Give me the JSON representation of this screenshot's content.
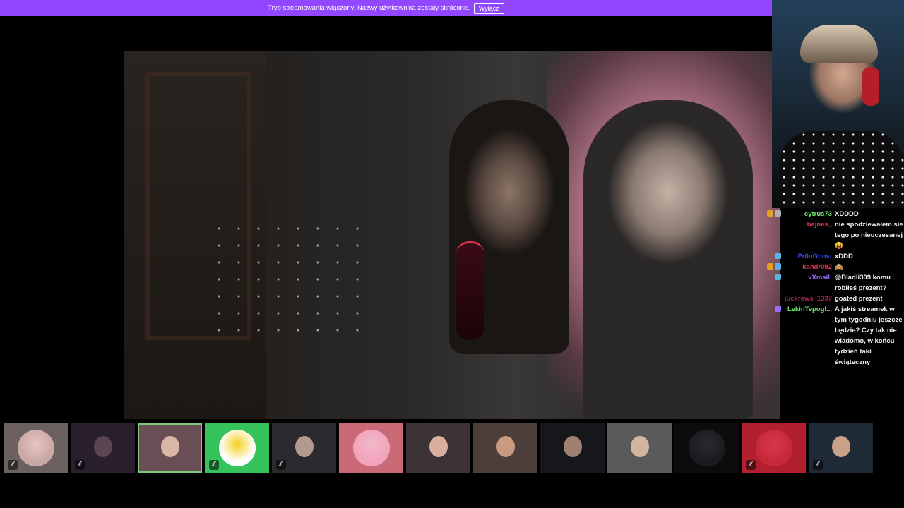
{
  "banner": {
    "text": "Tryb streamowania włączony. Nazwy użytkownika zostały skrócone.",
    "button": "Wyłącz",
    "color": "#9147ff"
  },
  "chat": {
    "messages": [
      {
        "user": "cytrus73",
        "user_color": "#6be86b",
        "text": "XDDDD",
        "badges": [
          "#e0a020",
          "#b0b0b0"
        ]
      },
      {
        "user": "bajnes_",
        "user_color": "#e0324c",
        "text": "nie spodziewałem sie tego po nieuczesanej 😝",
        "badges": []
      },
      {
        "user": "Pr0nGhost",
        "user_color": "#3a4cdb",
        "text": "xDDD",
        "badges": [
          "#58b5e8"
        ]
      },
      {
        "user": "kandr092",
        "user_color": "#e0324c",
        "text": "🙈",
        "badges": [
          "#e0a020",
          "#58b5e8"
        ]
      },
      {
        "user": "vXmaiL",
        "user_color": "#9b6bff",
        "text": "@Bladli309 komu robiłeś prezent?",
        "badges": [
          "#58b5e8"
        ]
      },
      {
        "user": "juckrews_1337",
        "user_color": "#a0264a",
        "text": "goated prezent",
        "badges": []
      },
      {
        "user": "LekinTepogl...",
        "user_color": "#6be86b",
        "text": "A jakiś streamek w tym tygodniu jeszcze będzie? Czy tak nie wiadomo, w końcu tydzień taki świąteczny",
        "badges": [
          "#9b6bff"
        ]
      }
    ]
  },
  "strip": {
    "tiles": [
      {
        "bg": "#6b6260",
        "face": "#e8c4c0",
        "muted": true,
        "active": false,
        "kind": "avatar",
        "avatar_bg": "#c9a9a6"
      },
      {
        "bg": "#2a1f2d",
        "face": "#5a4550",
        "muted": true,
        "active": false,
        "kind": "cam"
      },
      {
        "bg": "#6a4e55",
        "face": "#d9b6a5",
        "muted": false,
        "active": true,
        "kind": "cam"
      },
      {
        "bg": "#35c35b",
        "face": "#f5d020",
        "muted": true,
        "active": false,
        "kind": "avatar",
        "avatar_bg": "#ffffff"
      },
      {
        "bg": "#2b2a2e",
        "face": "#b49a8e",
        "muted": true,
        "active": false,
        "kind": "cam"
      },
      {
        "bg": "#c96a76",
        "face": "#f0b9c8",
        "muted": false,
        "active": false,
        "kind": "avatar",
        "avatar_bg": "#f2a4bd"
      },
      {
        "bg": "#3b3335",
        "face": "#d9b0a0",
        "muted": false,
        "active": false,
        "kind": "cam"
      },
      {
        "bg": "#4b3e3b",
        "face": "#c89a80",
        "muted": false,
        "active": false,
        "kind": "cam"
      },
      {
        "bg": "#16171a",
        "face": "#a08070",
        "muted": false,
        "active": false,
        "kind": "cam"
      },
      {
        "bg": "#5a5a5c",
        "face": "#d4b5a0",
        "muted": false,
        "active": false,
        "kind": "cam"
      },
      {
        "bg": "#0c0c0d",
        "face": "#2a2a2e",
        "muted": false,
        "active": false,
        "kind": "avatar",
        "avatar_bg": "#1c1b1f"
      },
      {
        "bg": "#b2202f",
        "face": "#d43a4c",
        "muted": true,
        "active": false,
        "kind": "avatar",
        "avatar_bg": "#c8293a"
      },
      {
        "bg": "#1e2a36",
        "face": "#c9a08a",
        "muted": true,
        "active": false,
        "kind": "cam"
      }
    ]
  }
}
